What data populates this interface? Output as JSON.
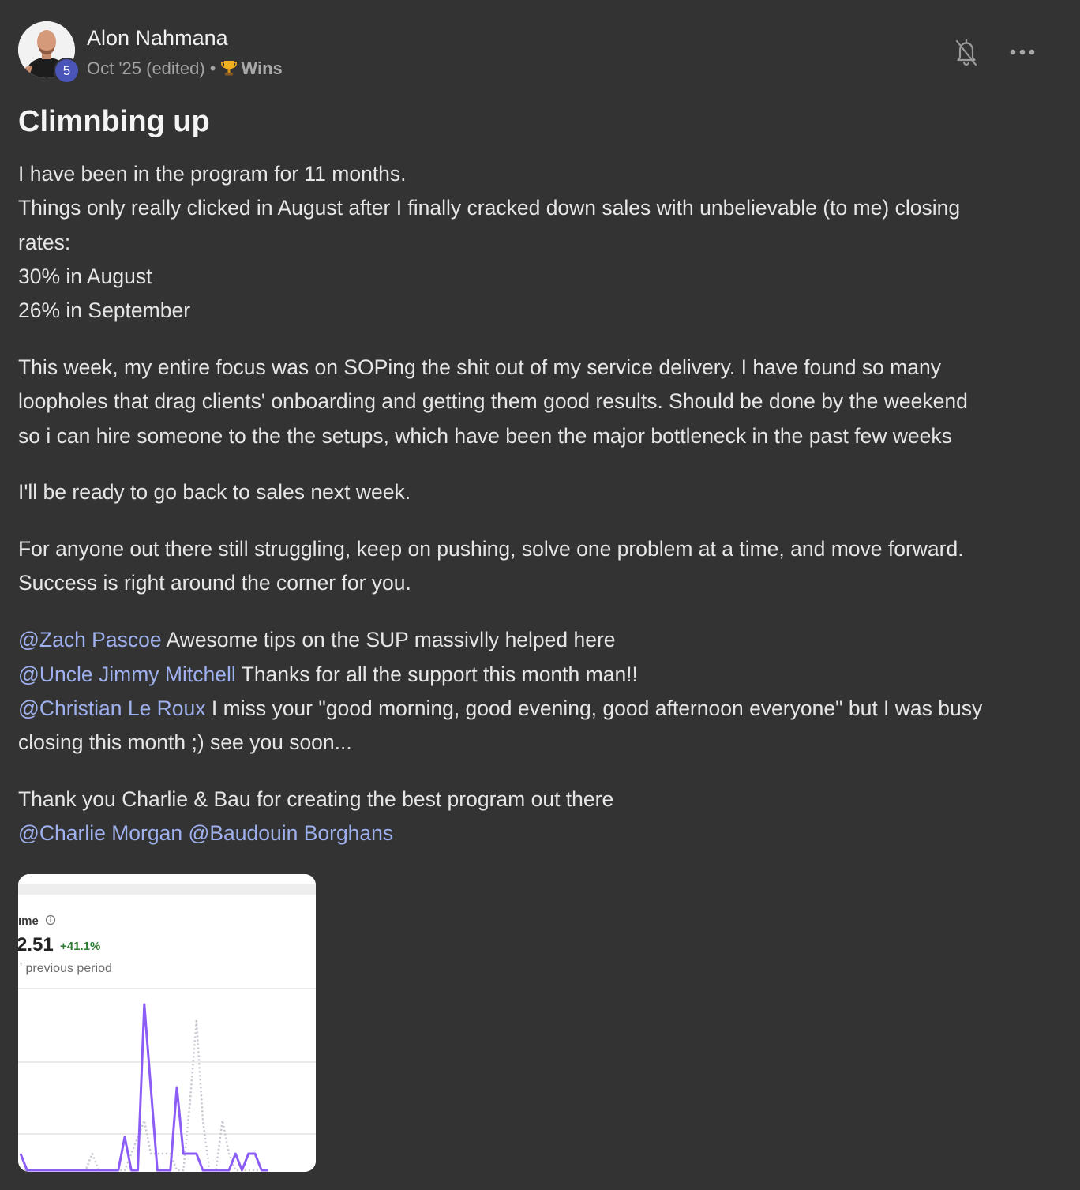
{
  "author": {
    "name": "Alon Nahmana",
    "level": "5",
    "date": "Oct '25 (edited)",
    "category": "Wins"
  },
  "post": {
    "title": "Climnbing up",
    "paragraph_1": [
      "I have been in the program for 11 months.",
      "Things only really clicked in August after I finally cracked down sales with unbelievable (to me) closing",
      "rates:",
      "30% in August",
      "26% in September"
    ],
    "paragraph_2": [
      "This week, my entire focus was on SOPing the shit out of my service delivery. I have found so many",
      "loopholes that drag clients' onboarding and getting them good results. Should be done by the weekend",
      "so i can hire someone to the the setups, which have been the major bottleneck in the past few weeks"
    ],
    "paragraph_3": "I'll be ready to go back to sales next week.",
    "paragraph_4": [
      "For anyone out there still struggling, keep on pushing, solve one problem at a time, and move forward.",
      "Success is right around the corner for you."
    ],
    "shoutouts": [
      {
        "mention": "@Zach Pascoe",
        "text": " Awesome tips on the SUP massivlly helped here"
      },
      {
        "mention": "@Uncle Jimmy Mitchell",
        "text": " Thanks for all the support this month man!!"
      },
      {
        "mention": "@Christian Le Roux",
        "text": " I miss your \"good morning, good evening, good afternoon everyone\" but I was busy"
      }
    ],
    "shoutout_continuation": "closing this month ;) see you soon...",
    "thanks_line": "Thank you Charlie & Bau for creating the best program out there",
    "final_mentions": [
      "@Charlie Morgan",
      "@Baudouin Borghans"
    ]
  },
  "attachment": {
    "label": "ıme",
    "value": "2.51",
    "change": "+41.1%",
    "comparison": "' previous period",
    "colors": {
      "current": "#8b5cf6",
      "previous": "#c4c6d0",
      "change": "#2e7d32"
    },
    "chart_data": {
      "type": "line",
      "series": [
        {
          "values": [
            1,
            0,
            0,
            0,
            0,
            0,
            0,
            0,
            0,
            0,
            0,
            0,
            0,
            0,
            0,
            0,
            2,
            0,
            0,
            10,
            5,
            0,
            0,
            0,
            5,
            1,
            1,
            1,
            0,
            0,
            0,
            0,
            0,
            1,
            0,
            1,
            1,
            0,
            0
          ]
        },
        {
          "values": [
            0,
            0,
            0,
            0,
            0,
            0,
            0,
            0,
            0,
            0,
            0,
            1,
            0,
            0,
            0,
            0,
            0,
            1,
            2,
            3,
            1,
            1,
            1,
            1,
            0,
            0,
            4,
            9,
            3,
            0,
            0,
            3,
            1,
            0,
            0,
            0,
            0,
            0,
            0
          ]
        }
      ]
    }
  }
}
